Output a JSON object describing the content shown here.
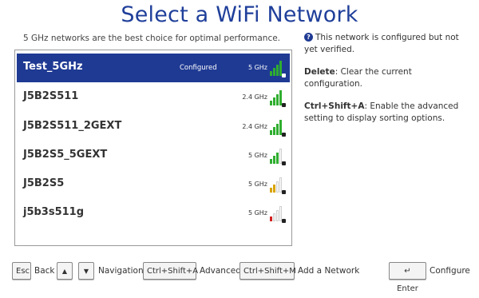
{
  "title": "Select a WiFi Network",
  "subtitle": "5 GHz networks are the best choice for optimal performance.",
  "networks": [
    {
      "name": "Test_5GHz",
      "status": "Configured",
      "band": "5 GHz",
      "signal_bars": 4,
      "color": "#2fae2f",
      "selected": true
    },
    {
      "name": "J5B2S511",
      "status": "",
      "band": "2.4 GHz",
      "signal_bars": 4,
      "color": "#2fae2f",
      "selected": false
    },
    {
      "name": "J5B2S511_2GEXT",
      "status": "",
      "band": "2.4 GHz",
      "signal_bars": 4,
      "color": "#2fae2f",
      "selected": false
    },
    {
      "name": "J5B2S5_5GEXT",
      "status": "",
      "band": "5 GHz",
      "signal_bars": 3,
      "color": "#2fae2f",
      "selected": false
    },
    {
      "name": "J5B2S5",
      "status": "",
      "band": "5 GHz",
      "signal_bars": 2,
      "color": "#d9a400",
      "selected": false
    },
    {
      "name": "j5b3s511g",
      "status": "",
      "band": "5 GHz",
      "signal_bars": 1,
      "color": "#d42020",
      "selected": false
    }
  ],
  "info": {
    "icon": "question-icon",
    "configured_note": "This network is configured but not yet verified.",
    "delete_key": "Delete",
    "delete_text": ": Clear the current configuration.",
    "advanced_key": "Ctrl+Shift+A",
    "advanced_text": ": Enable the advanced setting to display sorting options."
  },
  "footer": {
    "esc_key": "Esc",
    "esc_label": "Back",
    "up_key": "▲",
    "down_key": "▼",
    "nav_label": "Navigation",
    "adv_key": "Ctrl+Shift+A",
    "adv_label": "Advanced",
    "add_key": "Ctrl+Shift+M",
    "add_label": "Add a Network",
    "enter_key": "↵ Enter",
    "enter_label": "Configure"
  },
  "colors": {
    "accent": "#1f3a93",
    "title": "#1f3f9a",
    "bar_empty": "#d0d0d0"
  }
}
